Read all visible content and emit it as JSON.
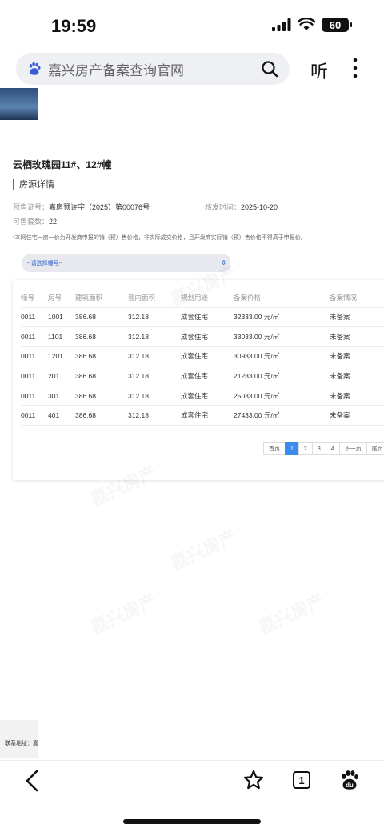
{
  "status": {
    "time": "19:59",
    "battery": "60"
  },
  "browser": {
    "address_text": "嘉兴房产备案查询官网",
    "listen_label": "听",
    "tab_count": "1"
  },
  "page": {
    "project_title": "云栖玫瑰园11#、12#幢",
    "section_title": "房源详情",
    "presale_label": "预售证号：",
    "presale_value": "嘉房预许字（2025）第00076号",
    "issue_label": "核发时间：",
    "issue_value": "2025-10-20",
    "units_label": "可售套数：",
    "units_value": "22",
    "notice": "*本网住宅一房一价为开发商申报的销（预）售价格，非实际成交价格，且开发商实际销（预）售价格不得高于申报价。",
    "select_placeholder": "--请选择幢号--",
    "watermark": "嘉兴房产"
  },
  "table": {
    "headers": [
      "幢号",
      "房号",
      "建筑面积",
      "套内面积",
      "规划用途",
      "备案价格",
      "备案情况"
    ],
    "rows": [
      [
        "0011",
        "1001",
        "386.68",
        "312.18",
        "成套住宅",
        "32333.00 元/㎡",
        "未备案"
      ],
      [
        "0011",
        "1101",
        "386.68",
        "312.18",
        "成套住宅",
        "33033.00 元/㎡",
        "未备案"
      ],
      [
        "0011",
        "1201",
        "386.68",
        "312.18",
        "成套住宅",
        "30933.00 元/㎡",
        "未备案"
      ],
      [
        "0011",
        "201",
        "386.68",
        "312.18",
        "成套住宅",
        "21233.00 元/㎡",
        "未备案"
      ],
      [
        "0011",
        "301",
        "386.68",
        "312.18",
        "成套住宅",
        "25033.00 元/㎡",
        "未备案"
      ],
      [
        "0011",
        "401",
        "386.68",
        "312.18",
        "成套住宅",
        "27433.00 元/㎡",
        "未备案"
      ]
    ]
  },
  "pager": {
    "first": "首页",
    "pages": [
      "1",
      "2",
      "3",
      "4"
    ],
    "next": "下一页",
    "last": "尾页",
    "current": "1"
  },
  "footer": {
    "contact": "联系地址：嘉"
  },
  "colors": {
    "accent": "#3b8af0",
    "link": "#2f5fd0"
  }
}
